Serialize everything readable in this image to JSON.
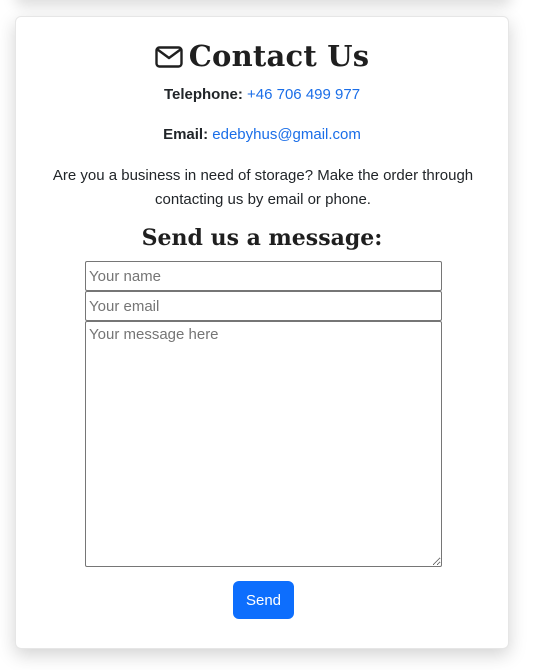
{
  "contact": {
    "title": "Contact Us",
    "icon": "envelope-icon",
    "telephone_label": "Telephone:",
    "telephone_value": "+46 706 499 977",
    "email_label": "Email:",
    "email_value": "edebyhus@gmail.com",
    "description": "Are you a business in need of storage? Make the order through contacting us by email or phone."
  },
  "form": {
    "heading": "Send us a message:",
    "name_placeholder": "Your name",
    "name_value": "",
    "email_placeholder": "Your email",
    "email_value": "",
    "message_placeholder": "Your message here",
    "message_value": "",
    "send_label": "Send"
  },
  "colors": {
    "link": "#1a6ee8",
    "button": "#0d6efd",
    "text": "#212529"
  }
}
